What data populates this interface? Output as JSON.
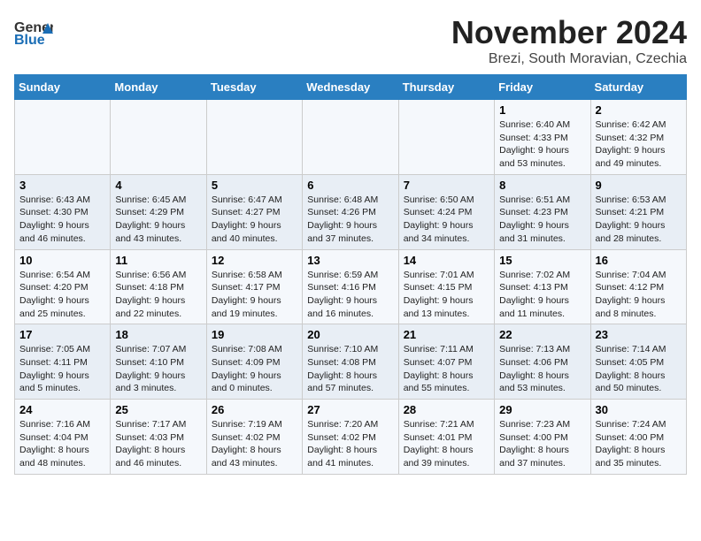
{
  "header": {
    "logo_general": "General",
    "logo_blue": "Blue",
    "month_title": "November 2024",
    "location": "Brezi, South Moravian, Czechia"
  },
  "weekdays": [
    "Sunday",
    "Monday",
    "Tuesday",
    "Wednesday",
    "Thursday",
    "Friday",
    "Saturday"
  ],
  "weeks": [
    [
      {
        "day": "",
        "info": ""
      },
      {
        "day": "",
        "info": ""
      },
      {
        "day": "",
        "info": ""
      },
      {
        "day": "",
        "info": ""
      },
      {
        "day": "",
        "info": ""
      },
      {
        "day": "1",
        "info": "Sunrise: 6:40 AM\nSunset: 4:33 PM\nDaylight: 9 hours and 53 minutes."
      },
      {
        "day": "2",
        "info": "Sunrise: 6:42 AM\nSunset: 4:32 PM\nDaylight: 9 hours and 49 minutes."
      }
    ],
    [
      {
        "day": "3",
        "info": "Sunrise: 6:43 AM\nSunset: 4:30 PM\nDaylight: 9 hours and 46 minutes."
      },
      {
        "day": "4",
        "info": "Sunrise: 6:45 AM\nSunset: 4:29 PM\nDaylight: 9 hours and 43 minutes."
      },
      {
        "day": "5",
        "info": "Sunrise: 6:47 AM\nSunset: 4:27 PM\nDaylight: 9 hours and 40 minutes."
      },
      {
        "day": "6",
        "info": "Sunrise: 6:48 AM\nSunset: 4:26 PM\nDaylight: 9 hours and 37 minutes."
      },
      {
        "day": "7",
        "info": "Sunrise: 6:50 AM\nSunset: 4:24 PM\nDaylight: 9 hours and 34 minutes."
      },
      {
        "day": "8",
        "info": "Sunrise: 6:51 AM\nSunset: 4:23 PM\nDaylight: 9 hours and 31 minutes."
      },
      {
        "day": "9",
        "info": "Sunrise: 6:53 AM\nSunset: 4:21 PM\nDaylight: 9 hours and 28 minutes."
      }
    ],
    [
      {
        "day": "10",
        "info": "Sunrise: 6:54 AM\nSunset: 4:20 PM\nDaylight: 9 hours and 25 minutes."
      },
      {
        "day": "11",
        "info": "Sunrise: 6:56 AM\nSunset: 4:18 PM\nDaylight: 9 hours and 22 minutes."
      },
      {
        "day": "12",
        "info": "Sunrise: 6:58 AM\nSunset: 4:17 PM\nDaylight: 9 hours and 19 minutes."
      },
      {
        "day": "13",
        "info": "Sunrise: 6:59 AM\nSunset: 4:16 PM\nDaylight: 9 hours and 16 minutes."
      },
      {
        "day": "14",
        "info": "Sunrise: 7:01 AM\nSunset: 4:15 PM\nDaylight: 9 hours and 13 minutes."
      },
      {
        "day": "15",
        "info": "Sunrise: 7:02 AM\nSunset: 4:13 PM\nDaylight: 9 hours and 11 minutes."
      },
      {
        "day": "16",
        "info": "Sunrise: 7:04 AM\nSunset: 4:12 PM\nDaylight: 9 hours and 8 minutes."
      }
    ],
    [
      {
        "day": "17",
        "info": "Sunrise: 7:05 AM\nSunset: 4:11 PM\nDaylight: 9 hours and 5 minutes."
      },
      {
        "day": "18",
        "info": "Sunrise: 7:07 AM\nSunset: 4:10 PM\nDaylight: 9 hours and 3 minutes."
      },
      {
        "day": "19",
        "info": "Sunrise: 7:08 AM\nSunset: 4:09 PM\nDaylight: 9 hours and 0 minutes."
      },
      {
        "day": "20",
        "info": "Sunrise: 7:10 AM\nSunset: 4:08 PM\nDaylight: 8 hours and 57 minutes."
      },
      {
        "day": "21",
        "info": "Sunrise: 7:11 AM\nSunset: 4:07 PM\nDaylight: 8 hours and 55 minutes."
      },
      {
        "day": "22",
        "info": "Sunrise: 7:13 AM\nSunset: 4:06 PM\nDaylight: 8 hours and 53 minutes."
      },
      {
        "day": "23",
        "info": "Sunrise: 7:14 AM\nSunset: 4:05 PM\nDaylight: 8 hours and 50 minutes."
      }
    ],
    [
      {
        "day": "24",
        "info": "Sunrise: 7:16 AM\nSunset: 4:04 PM\nDaylight: 8 hours and 48 minutes."
      },
      {
        "day": "25",
        "info": "Sunrise: 7:17 AM\nSunset: 4:03 PM\nDaylight: 8 hours and 46 minutes."
      },
      {
        "day": "26",
        "info": "Sunrise: 7:19 AM\nSunset: 4:02 PM\nDaylight: 8 hours and 43 minutes."
      },
      {
        "day": "27",
        "info": "Sunrise: 7:20 AM\nSunset: 4:02 PM\nDaylight: 8 hours and 41 minutes."
      },
      {
        "day": "28",
        "info": "Sunrise: 7:21 AM\nSunset: 4:01 PM\nDaylight: 8 hours and 39 minutes."
      },
      {
        "day": "29",
        "info": "Sunrise: 7:23 AM\nSunset: 4:00 PM\nDaylight: 8 hours and 37 minutes."
      },
      {
        "day": "30",
        "info": "Sunrise: 7:24 AM\nSunset: 4:00 PM\nDaylight: 8 hours and 35 minutes."
      }
    ]
  ]
}
